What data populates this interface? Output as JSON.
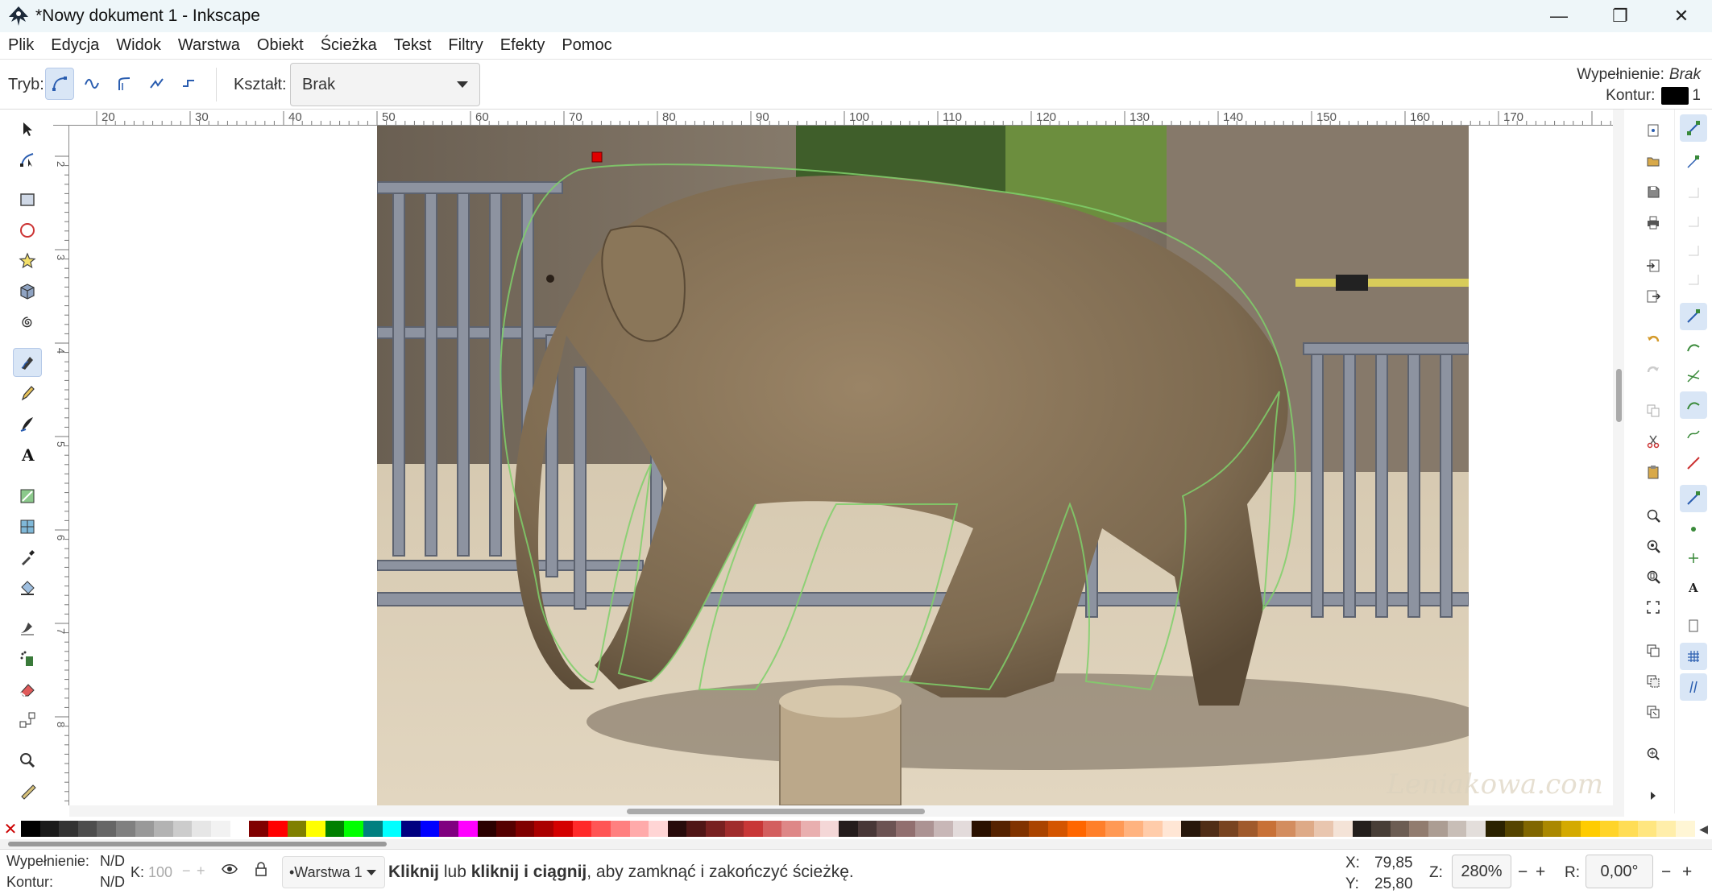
{
  "window": {
    "title": "*Nowy dokument 1 - Inkscape",
    "minimize": "—",
    "maximize": "❐",
    "close": "✕"
  },
  "menu": [
    "Plik",
    "Edycja",
    "Widok",
    "Warstwa",
    "Obiekt",
    "Ścieżka",
    "Tekst",
    "Filtry",
    "Efekty",
    "Pomoc"
  ],
  "tool_controls": {
    "mode_label": "Tryb:",
    "shape_label": "Kształt:",
    "shape_value": "Brak"
  },
  "style_indicator": {
    "fill_label": "Wypełnienie:",
    "fill_value": "Brak",
    "stroke_label": "Kontur:",
    "stroke_width": "1",
    "stroke_color": "#000000"
  },
  "ruler": {
    "top_labels": [
      "20",
      "30",
      "40",
      "50",
      "60",
      "70",
      "80",
      "90",
      "100",
      "110",
      "120",
      "130",
      "140",
      "150",
      "160",
      "170"
    ],
    "left_labels": [
      "2",
      "3",
      "4",
      "5",
      "6",
      "7",
      "8"
    ]
  },
  "canvas": {
    "watermark": "Leniakowa.com"
  },
  "palette": {
    "colors": [
      "#000000",
      "#1a1a1a",
      "#333333",
      "#4d4d4d",
      "#666666",
      "#808080",
      "#999999",
      "#b3b3b3",
      "#cccccc",
      "#e6e6e6",
      "#f2f2f2",
      "#ffffff",
      "#800000",
      "#ff0000",
      "#808000",
      "#ffff00",
      "#008000",
      "#00ff00",
      "#008080",
      "#00ffff",
      "#000080",
      "#0000ff",
      "#800080",
      "#ff00ff",
      "#2b0000",
      "#550000",
      "#800000",
      "#aa0000",
      "#d40000",
      "#ff2a2a",
      "#ff5555",
      "#ff8080",
      "#ffaaaa",
      "#ffd5d5",
      "#280b0b",
      "#501616",
      "#782121",
      "#a02c2c",
      "#c83737",
      "#d35f5f",
      "#de8787",
      "#e9afaf",
      "#f4d7d7",
      "#241c1c",
      "#483737",
      "#6c5353",
      "#916f6f",
      "#ac9393",
      "#c8b7b7",
      "#e3dbdb",
      "#2b1100",
      "#552200",
      "#803300",
      "#aa4400",
      "#d45500",
      "#ff6600",
      "#ff7f2a",
      "#ff9955",
      "#ffb380",
      "#ffccaa",
      "#ffe6d5",
      "#28170b",
      "#502d16",
      "#784421",
      "#a05a2c",
      "#c87137",
      "#d38d5f",
      "#deaa87",
      "#e9c6af",
      "#f4e3d7",
      "#241f1c",
      "#483e37",
      "#6c5d53",
      "#917c6f",
      "#ac9d93",
      "#c8beb7",
      "#e3dedb",
      "#2b2200",
      "#554400",
      "#806600",
      "#aa8800",
      "#d4aa00",
      "#ffcc00",
      "#ffd42a",
      "#ffdd55",
      "#ffe680",
      "#ffeeaa",
      "#fff6d5"
    ]
  },
  "status": {
    "fill_label": "Wypełnienie:",
    "fill_value": "N/D",
    "stroke_label": "Kontur:",
    "stroke_value": "N/D",
    "opacity_label": "K:",
    "opacity_value": "100",
    "layer": "•Warstwa 1",
    "message_bold1": "Kliknij",
    "message_mid1": " lub ",
    "message_bold2": "kliknij i ciągnij",
    "message_rest": ", aby zamknąć i zakończyć ścieżkę.",
    "x_label": "X:",
    "x_value": "79,85",
    "y_label": "Y:",
    "y_value": "25,80",
    "zoom_label": "Z:",
    "zoom_value": "280%",
    "rotation_label": "R:",
    "rotation_value": "0,00°",
    "minus": "−",
    "plus": "+"
  }
}
